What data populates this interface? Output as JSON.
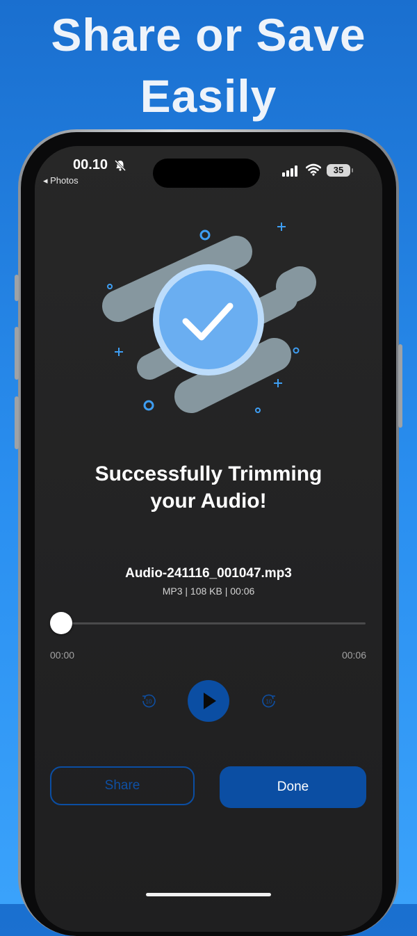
{
  "headline": {
    "line1": "Share or Save",
    "line2": "Easily"
  },
  "status_bar": {
    "time": "00.10",
    "back_label": "◂ Photos",
    "battery_level": "35"
  },
  "success": {
    "title_line1": "Successfully Trimming",
    "title_line2": "your Audio!"
  },
  "file": {
    "name": "Audio-241116_001047.mp3",
    "meta": "MP3 | 108 KB | 00:06"
  },
  "player": {
    "current_time": "00:00",
    "total_time": "00:06",
    "progress": 0,
    "skip_back_seconds": "10",
    "skip_forward_seconds": "10"
  },
  "actions": {
    "share_label": "Share",
    "done_label": "Done"
  },
  "colors": {
    "accent": "#0b4ea3",
    "check_badge": "#6aaef1",
    "background_top": "#1a6fcf",
    "background_bottom": "#3aa2fb"
  },
  "icons": [
    "bell-slash-icon",
    "signal-icon",
    "wifi-icon",
    "checkmark-icon",
    "skip-back-10-icon",
    "play-icon",
    "skip-forward-10-icon"
  ]
}
